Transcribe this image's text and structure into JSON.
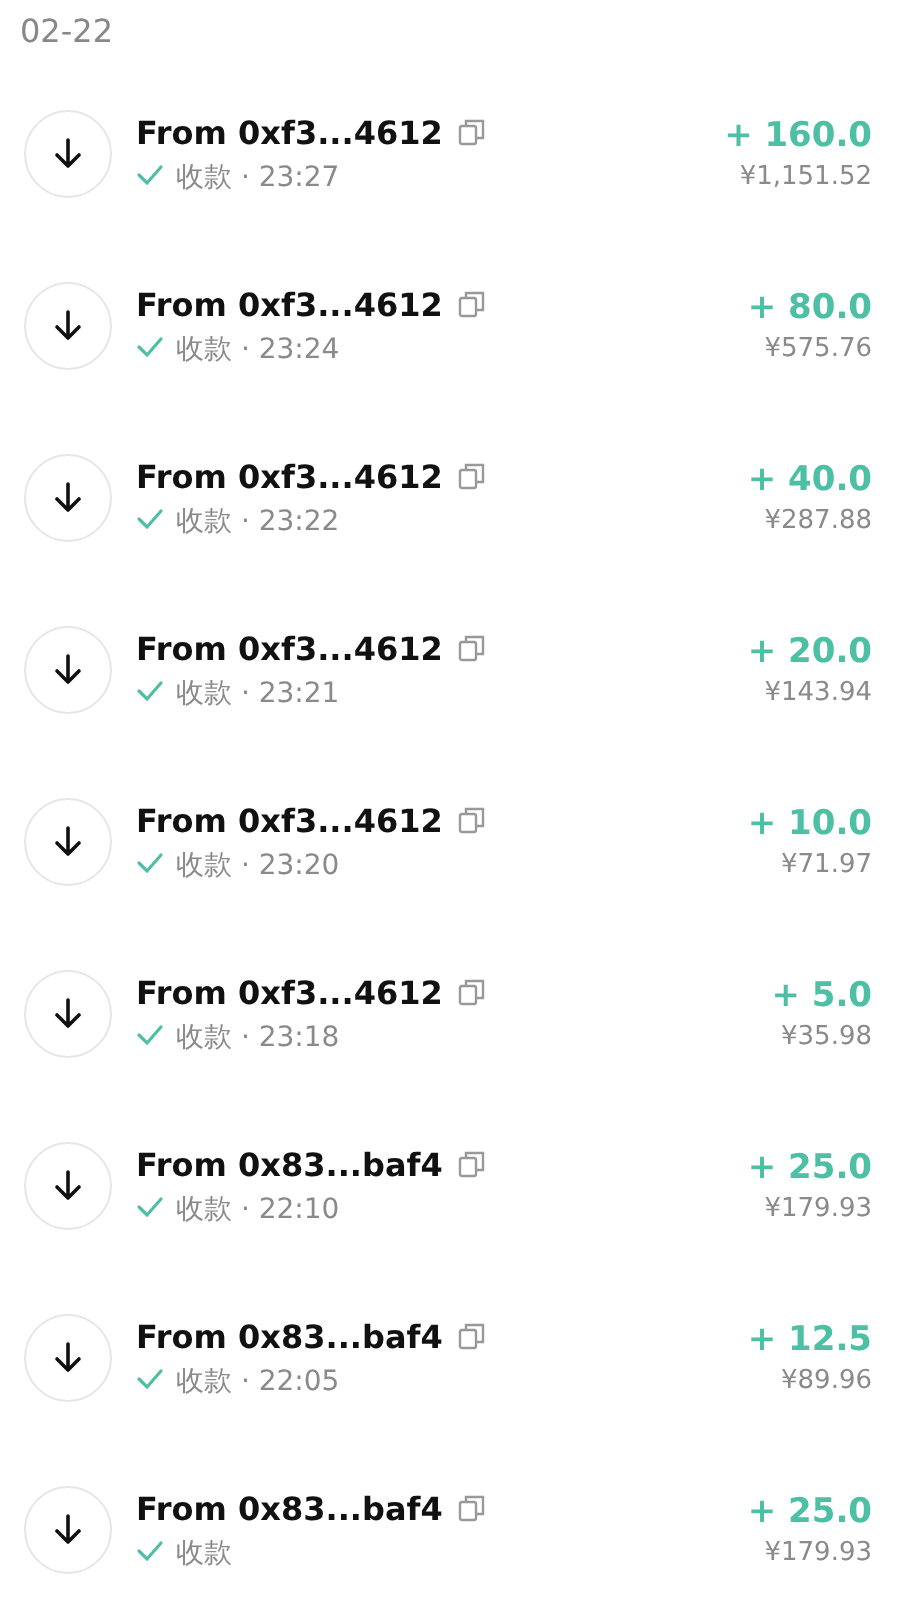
{
  "date": "02-22",
  "transactions": [
    {
      "title": "From 0xf3...4612",
      "confirmed": true,
      "status": "收款 · 23:27",
      "amount": "+ 160.0",
      "fiat": "¥1,151.52"
    },
    {
      "title": "From 0xf3...4612",
      "confirmed": true,
      "status": "收款 · 23:24",
      "amount": "+ 80.0",
      "fiat": "¥575.76"
    },
    {
      "title": "From 0xf3...4612",
      "confirmed": true,
      "status": "收款 · 23:22",
      "amount": "+ 40.0",
      "fiat": "¥287.88"
    },
    {
      "title": "From 0xf3...4612",
      "confirmed": true,
      "status": "收款 · 23:21",
      "amount": "+ 20.0",
      "fiat": "¥143.94"
    },
    {
      "title": "From 0xf3...4612",
      "confirmed": true,
      "status": "收款 · 23:20",
      "amount": "+ 10.0",
      "fiat": "¥71.97"
    },
    {
      "title": "From 0xf3...4612",
      "confirmed": true,
      "status": "收款 · 23:18",
      "amount": "+ 5.0",
      "fiat": "¥35.98"
    },
    {
      "title": "From 0x83...baf4",
      "confirmed": true,
      "status": "收款 · 22:10",
      "amount": "+ 25.0",
      "fiat": "¥179.93"
    },
    {
      "title": "From 0x83...baf4",
      "confirmed": true,
      "status": "收款 · 22:05",
      "amount": "+ 12.5",
      "fiat": "¥89.96"
    },
    {
      "title": "From 0x83...baf4",
      "confirmed": true,
      "status": "收款",
      "amount": "+ 25.0",
      "fiat": "¥179.93"
    }
  ]
}
